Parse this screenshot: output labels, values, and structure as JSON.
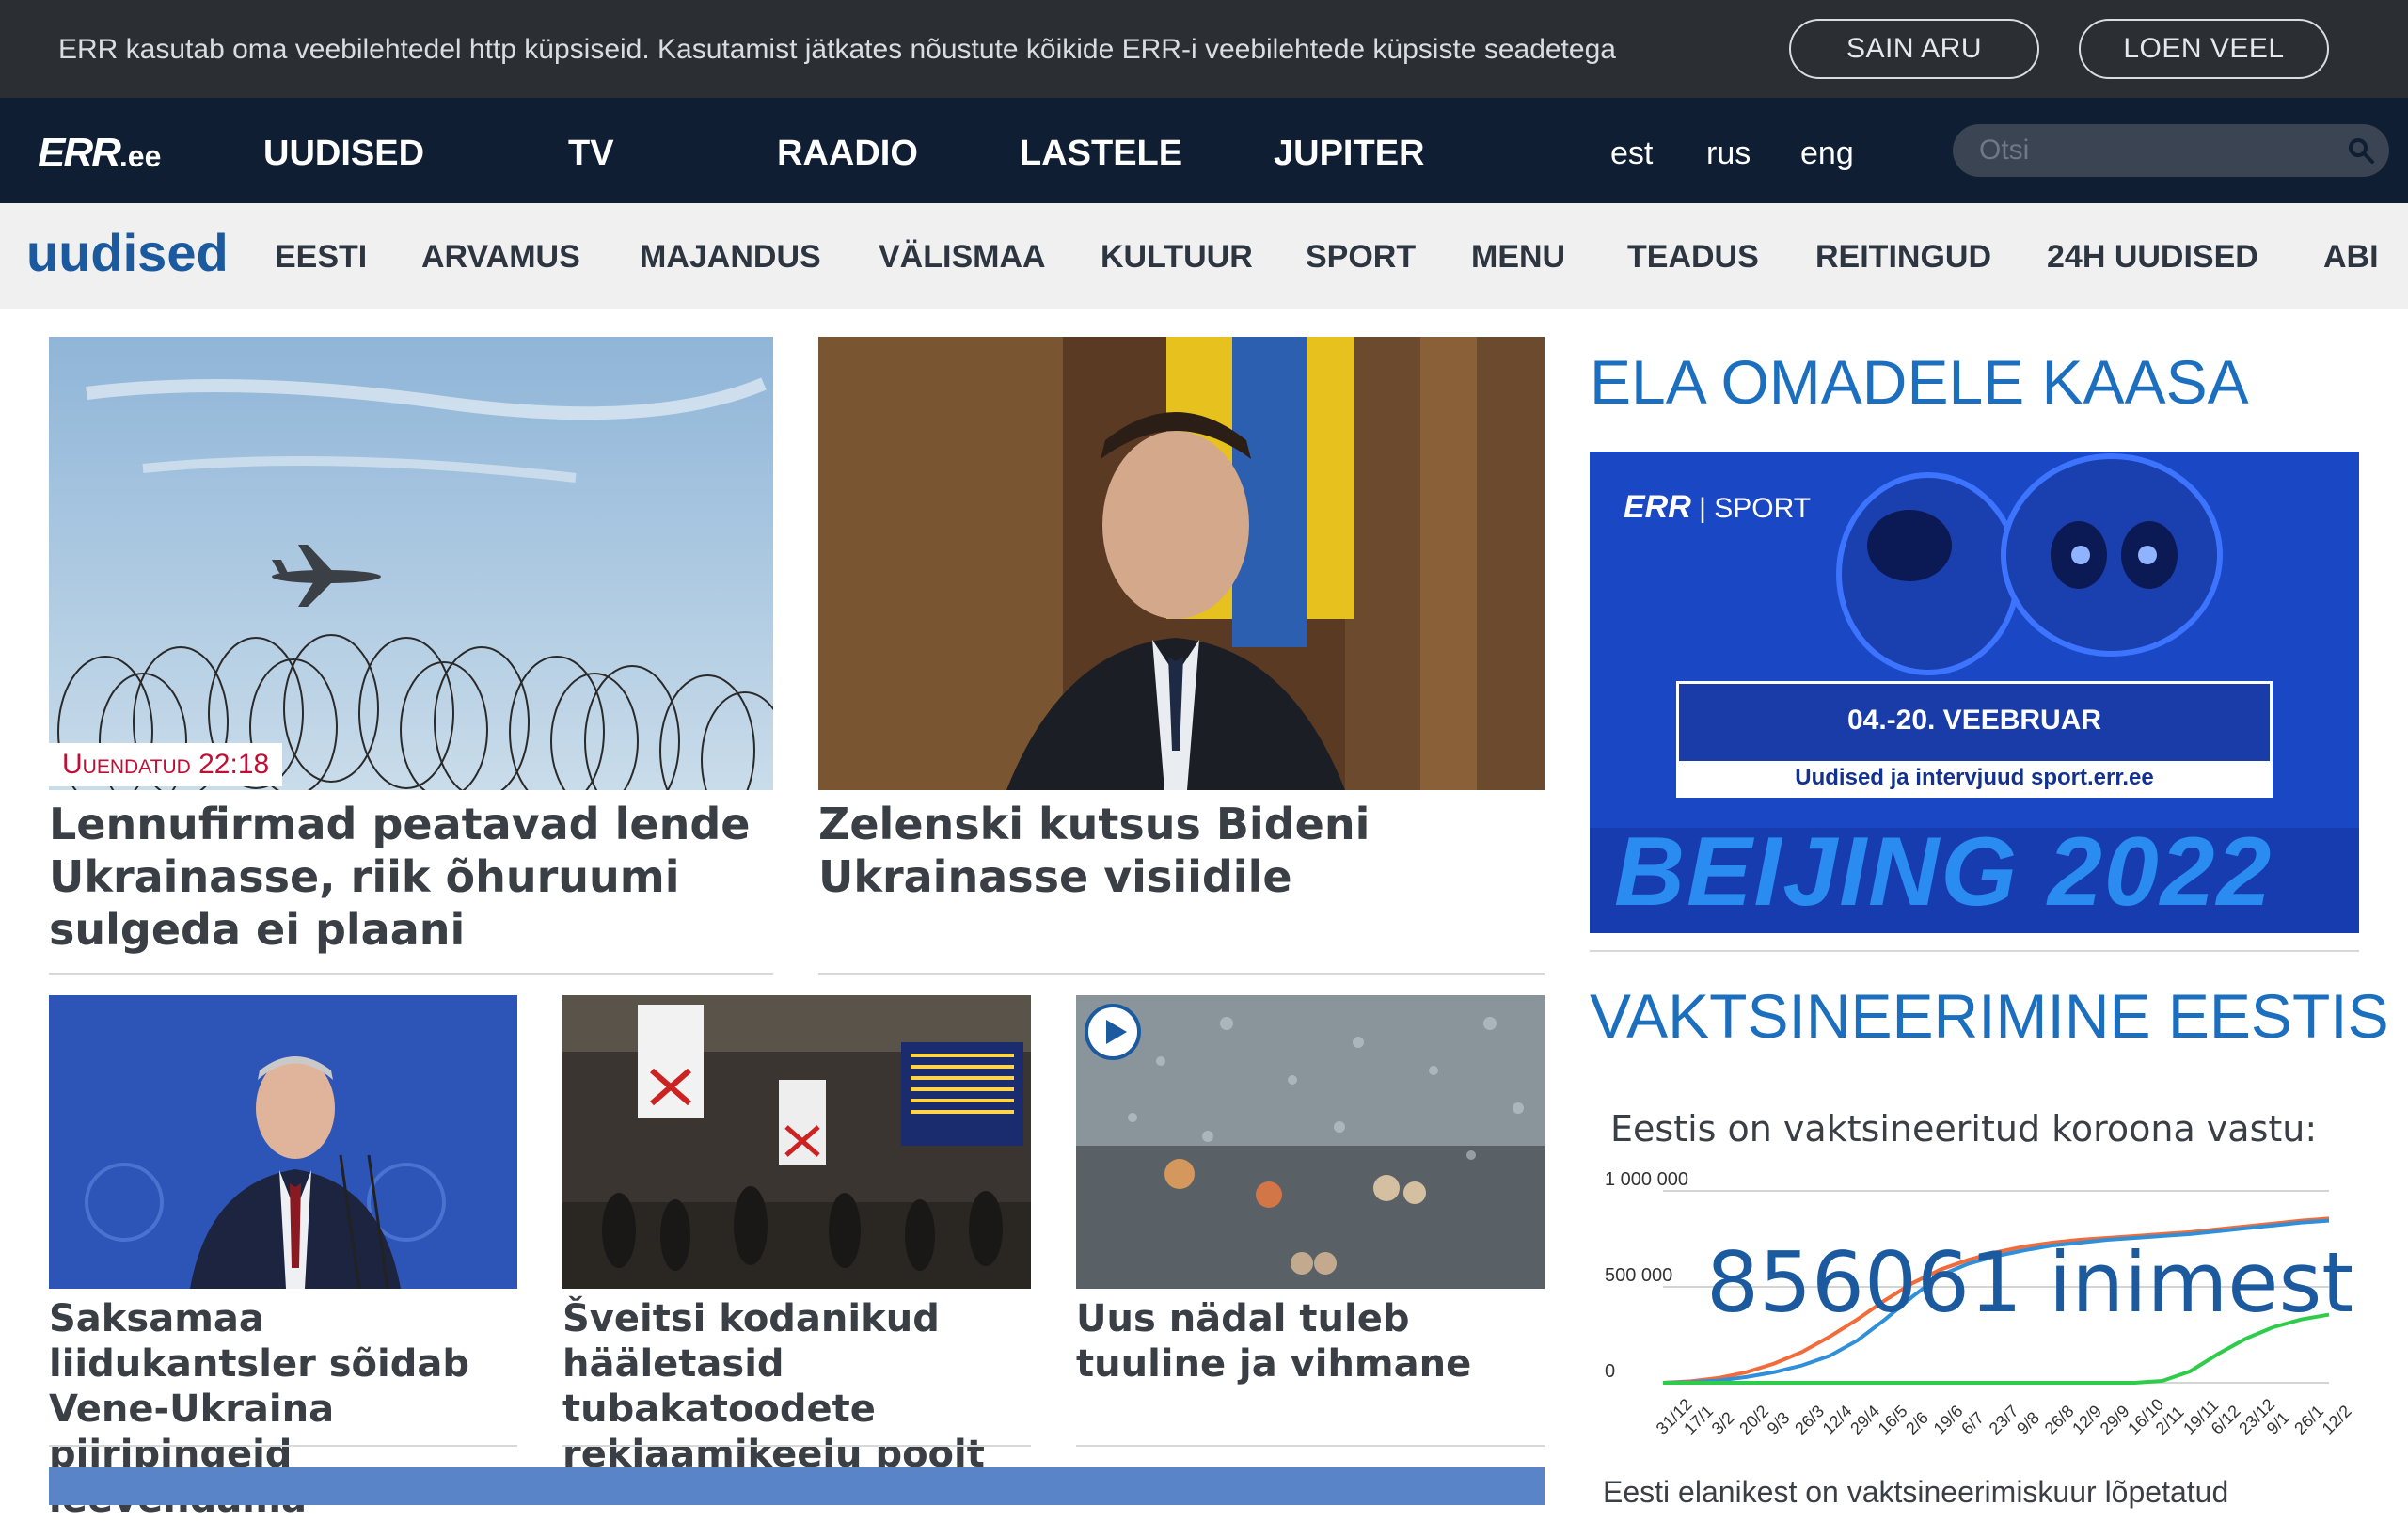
{
  "cookie": {
    "text": "ERR kasutab oma veebilehtedel http küpsiseid. Kasutamist jätkates nõustute kõikide ERR-i veebilehtede küpsiste seadetega",
    "accept_label": "SAIN ARU",
    "more_label": "LOEN VEEL"
  },
  "topnav": {
    "logo": "ERR",
    "logo_suffix": ".ee",
    "items": [
      "UUDISED",
      "TV",
      "RAADIO",
      "LASTELE",
      "JUPITER"
    ],
    "languages": [
      "est",
      "rus",
      "eng"
    ],
    "search_placeholder": "Otsi"
  },
  "section": {
    "title": "uudised",
    "items": [
      "EESTI",
      "ARVAMUS",
      "MAJANDUS",
      "VÄLISMAA",
      "KULTUUR",
      "SPORT",
      "MENU",
      "TEADUS",
      "REITINGUD",
      "24H UUDISED",
      "ABI"
    ]
  },
  "articles": {
    "a1": {
      "badge": "Uuendatud 22:18",
      "title": "Lennufirmad peatavad lende Ukrainasse, riik õhuruumi sulgeda ei plaani"
    },
    "a2": {
      "title": "Zelenski kutsus Bideni Ukrainasse visiidile"
    },
    "a3": {
      "title": "Saksamaa liidukantsler sõidab Vene-Ukraina piiripingeid leevendama"
    },
    "a4": {
      "title": "Šveitsi kodanikud hääletasid tubakatoodete reklaamikeelu poolt"
    },
    "a5": {
      "title": "Uus nädal tuleb tuuline ja vihmane"
    }
  },
  "sidebar": {
    "heading1": "ELA OMADELE KAASA",
    "banner": {
      "brand": "ERR",
      "brand_section": "| SPORT",
      "dates": "04.-20. VEEBRUAR",
      "info": "Uudised ja intervjuud sport.err.ee",
      "event": "BEIJING 2022"
    },
    "heading2": "VAKTSINEERIMINE EESTIS",
    "chart_title": "Eestis on vaktsineeritud koroona vastu:",
    "chart_caption": "Eesti elanikest on vaktsineerimiskuur lõpetatud"
  },
  "chart_data": {
    "type": "line",
    "title": "Eestis on vaktsineeritud koroona vastu:",
    "highlight_value": "856061",
    "highlight_unit": "inimest",
    "x": [
      "31/12",
      "17/1",
      "3/2",
      "20/2",
      "9/3",
      "26/3",
      "12/4",
      "29/4",
      "16/5",
      "2/6",
      "19/6",
      "6/7",
      "23/7",
      "9/8",
      "26/8",
      "12/9",
      "29/9",
      "16/10",
      "2/11",
      "19/11",
      "6/12",
      "23/12",
      "9/1",
      "26/1",
      "12/2"
    ],
    "ylim": [
      0,
      1000000
    ],
    "yticks": [
      "0",
      "500 000",
      "1 000 000"
    ],
    "series": [
      {
        "color": "#f26b3a",
        "values": [
          0,
          8000,
          25000,
          55000,
          100000,
          160000,
          240000,
          330000,
          430000,
          520000,
          590000,
          640000,
          680000,
          710000,
          730000,
          745000,
          755000,
          765000,
          775000,
          785000,
          800000,
          815000,
          830000,
          845000,
          856061
        ]
      },
      {
        "color": "#2f8fd8",
        "values": [
          0,
          3000,
          12000,
          30000,
          55000,
          90000,
          140000,
          220000,
          330000,
          450000,
          560000,
          620000,
          660000,
          690000,
          715000,
          730000,
          745000,
          755000,
          765000,
          775000,
          790000,
          805000,
          820000,
          835000,
          845000
        ]
      },
      {
        "color": "#2ecc4a",
        "values": [
          0,
          0,
          0,
          0,
          0,
          0,
          0,
          0,
          0,
          0,
          0,
          0,
          0,
          0,
          0,
          0,
          0,
          0,
          10000,
          60000,
          150000,
          230000,
          290000,
          330000,
          355000
        ]
      }
    ]
  },
  "colors": {
    "cookie_bg": "#2b2f33",
    "nav_bg": "#0f1e33",
    "brand_blue": "#1c5aa0",
    "accent_red": "#c20e35"
  }
}
